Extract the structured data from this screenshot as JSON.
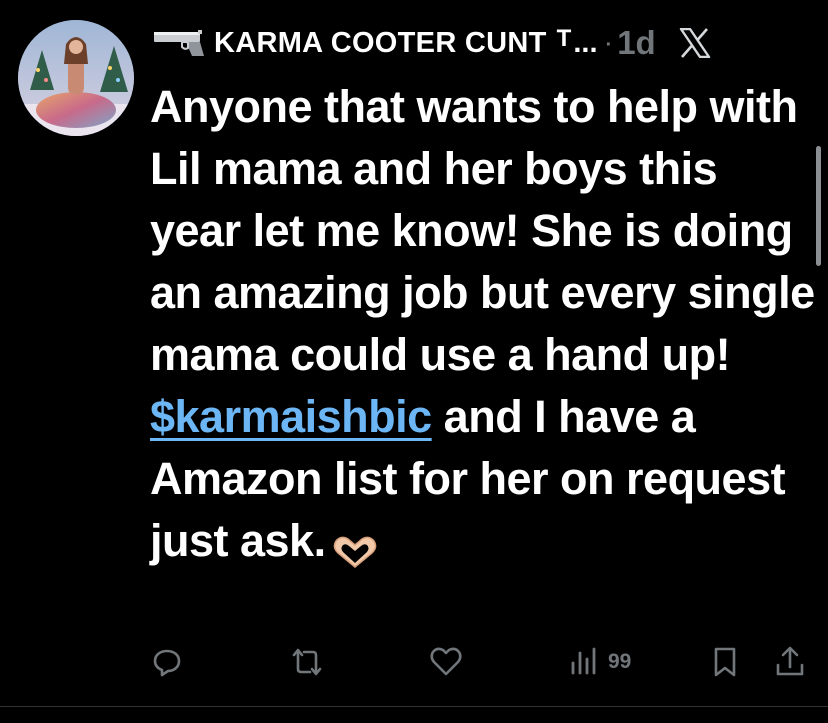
{
  "tweet": {
    "display_name": "KARMA COOTER CUNT",
    "name_suffix": "T",
    "name_ellipsis": "...",
    "separator": "·",
    "timestamp": "1d",
    "body_lines": {
      "part1": "Anyone that wants to help with Lil mama and her boys this year let me know! She is doing an amazing job but every single mama could use a hand up!",
      "cashtag": "$karmaishbic",
      "part2": " and I have a Amazon list for her on request just ask."
    },
    "emoji_name": "heart-hands-emoji",
    "header_icon": "gun-icon",
    "brand_icon": "x-logo-icon"
  },
  "actions": {
    "reply_icon": "reply-icon",
    "retweet_icon": "retweet-icon",
    "like_icon": "like-heart-icon",
    "views_icon": "views-bar-chart-icon",
    "views_count": "99",
    "bookmark_icon": "bookmark-icon",
    "share_icon": "share-icon"
  },
  "colors": {
    "background": "#000000",
    "text": "#ffffff",
    "secondary": "#71767b",
    "link": "#6cb6f5"
  }
}
